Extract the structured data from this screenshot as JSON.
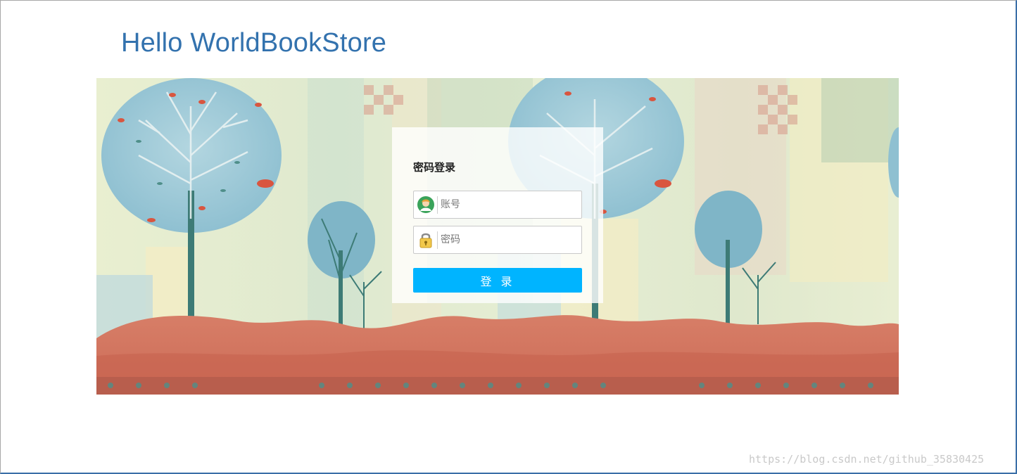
{
  "header": {
    "title": "Hello WorldBookStore"
  },
  "banner": {
    "image": "illustrated-trees-background"
  },
  "login": {
    "title": "密码登录",
    "account_placeholder": "账号",
    "account_icon": "user-avatar-icon",
    "password_placeholder": "密码",
    "password_icon": "lock-icon",
    "submit_label": "登 录"
  },
  "watermark": "https://blog.csdn.net/github_35830425",
  "colors": {
    "title": "#3372ae",
    "button": "#00b4ff",
    "frame_accent": "#3a6fa8"
  }
}
